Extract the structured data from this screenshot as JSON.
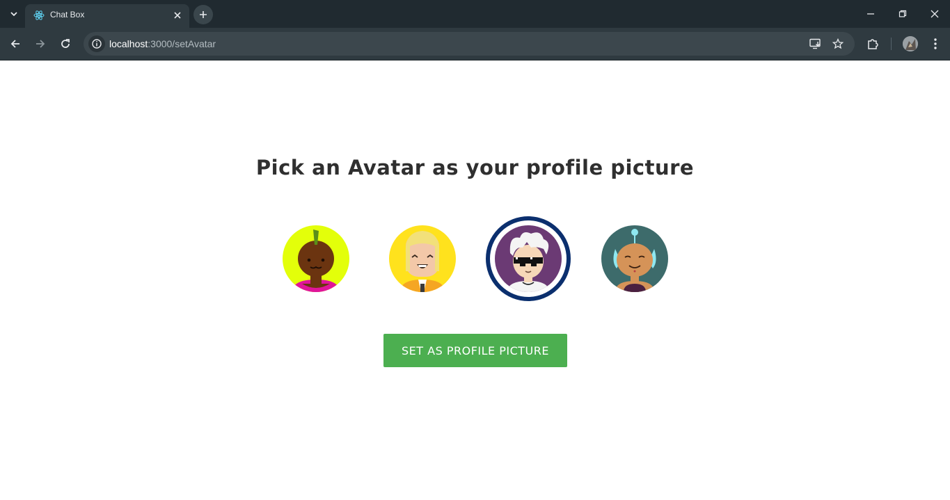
{
  "browser": {
    "tab_title": "Chat Box",
    "url_host": "localhost",
    "url_path": ":3000/setAvatar"
  },
  "page": {
    "heading": "Pick an Avatar as your profile picture",
    "avatars": [
      {
        "name": "avatar-1",
        "bg": "#e6ff00",
        "selected": false
      },
      {
        "name": "avatar-2",
        "bg": "#ffe11a",
        "selected": false
      },
      {
        "name": "avatar-3",
        "bg": "#6b3a74",
        "selected": true
      },
      {
        "name": "avatar-4",
        "bg": "#3d6b6b",
        "selected": false
      }
    ],
    "button_label": "SET AS PROFILE PICTURE",
    "colors": {
      "button": "#4caf50",
      "selected_ring": "#0b2f6e",
      "heading": "#2f2f2f"
    }
  }
}
